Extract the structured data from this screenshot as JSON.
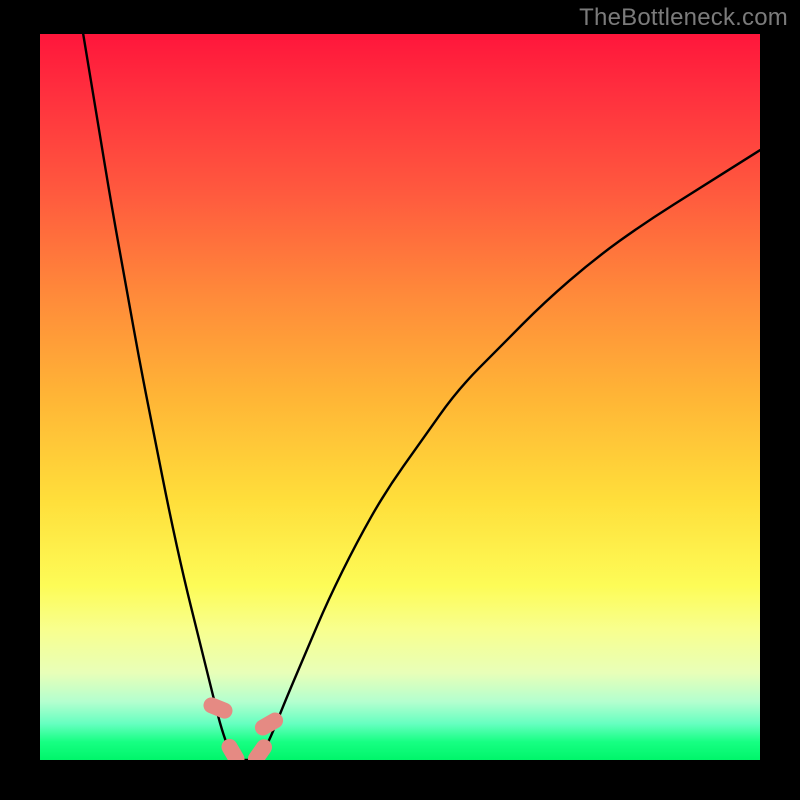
{
  "watermark": "TheBottleneck.com",
  "colors": {
    "frame": "#000000",
    "watermark": "#7b7b7b",
    "curve": "#000000",
    "marker": "#e58a83",
    "gradient_stops": [
      "#ff163b",
      "#ff2f3e",
      "#ff5a3e",
      "#ff8a3a",
      "#ffb536",
      "#ffde3a",
      "#fdfc57",
      "#f8ff8e",
      "#e8ffb8",
      "#b3ffcf",
      "#66ffc0",
      "#17ff83",
      "#00f56a"
    ]
  },
  "chart_data": {
    "type": "line",
    "title": "",
    "xlabel": "",
    "ylabel": "",
    "xlim": [
      0,
      100
    ],
    "ylim": [
      0,
      100
    ],
    "legend": false,
    "grid": false,
    "background": "rainbow-vertical-gradient",
    "series": [
      {
        "name": "left-branch",
        "x": [
          6,
          8,
          10,
          12,
          14,
          16,
          18,
          20,
          22,
          24,
          25,
          26,
          26.8
        ],
        "y": [
          100,
          88,
          76,
          65,
          54,
          44,
          34,
          25,
          17,
          9,
          5,
          2,
          0
        ]
      },
      {
        "name": "right-branch",
        "x": [
          30.4,
          32,
          34,
          37,
          40,
          44,
          48,
          53,
          58,
          64,
          70,
          77,
          84,
          92,
          100
        ],
        "y": [
          0,
          3,
          8,
          15,
          22,
          30,
          37,
          44,
          51,
          57,
          63,
          69,
          74,
          79,
          84
        ]
      }
    ],
    "flat_segment": {
      "x_start": 26.8,
      "x_end": 30.4,
      "y": 0
    },
    "markers": [
      {
        "label": "left-top",
        "x": 24.7,
        "y": 7.2,
        "angle_deg": -68
      },
      {
        "label": "left-bot",
        "x": 26.8,
        "y": 1.0,
        "angle_deg": -30
      },
      {
        "label": "right-bot",
        "x": 30.5,
        "y": 1.0,
        "angle_deg": 35
      },
      {
        "label": "right-top",
        "x": 31.8,
        "y": 5.0,
        "angle_deg": 60
      }
    ]
  }
}
